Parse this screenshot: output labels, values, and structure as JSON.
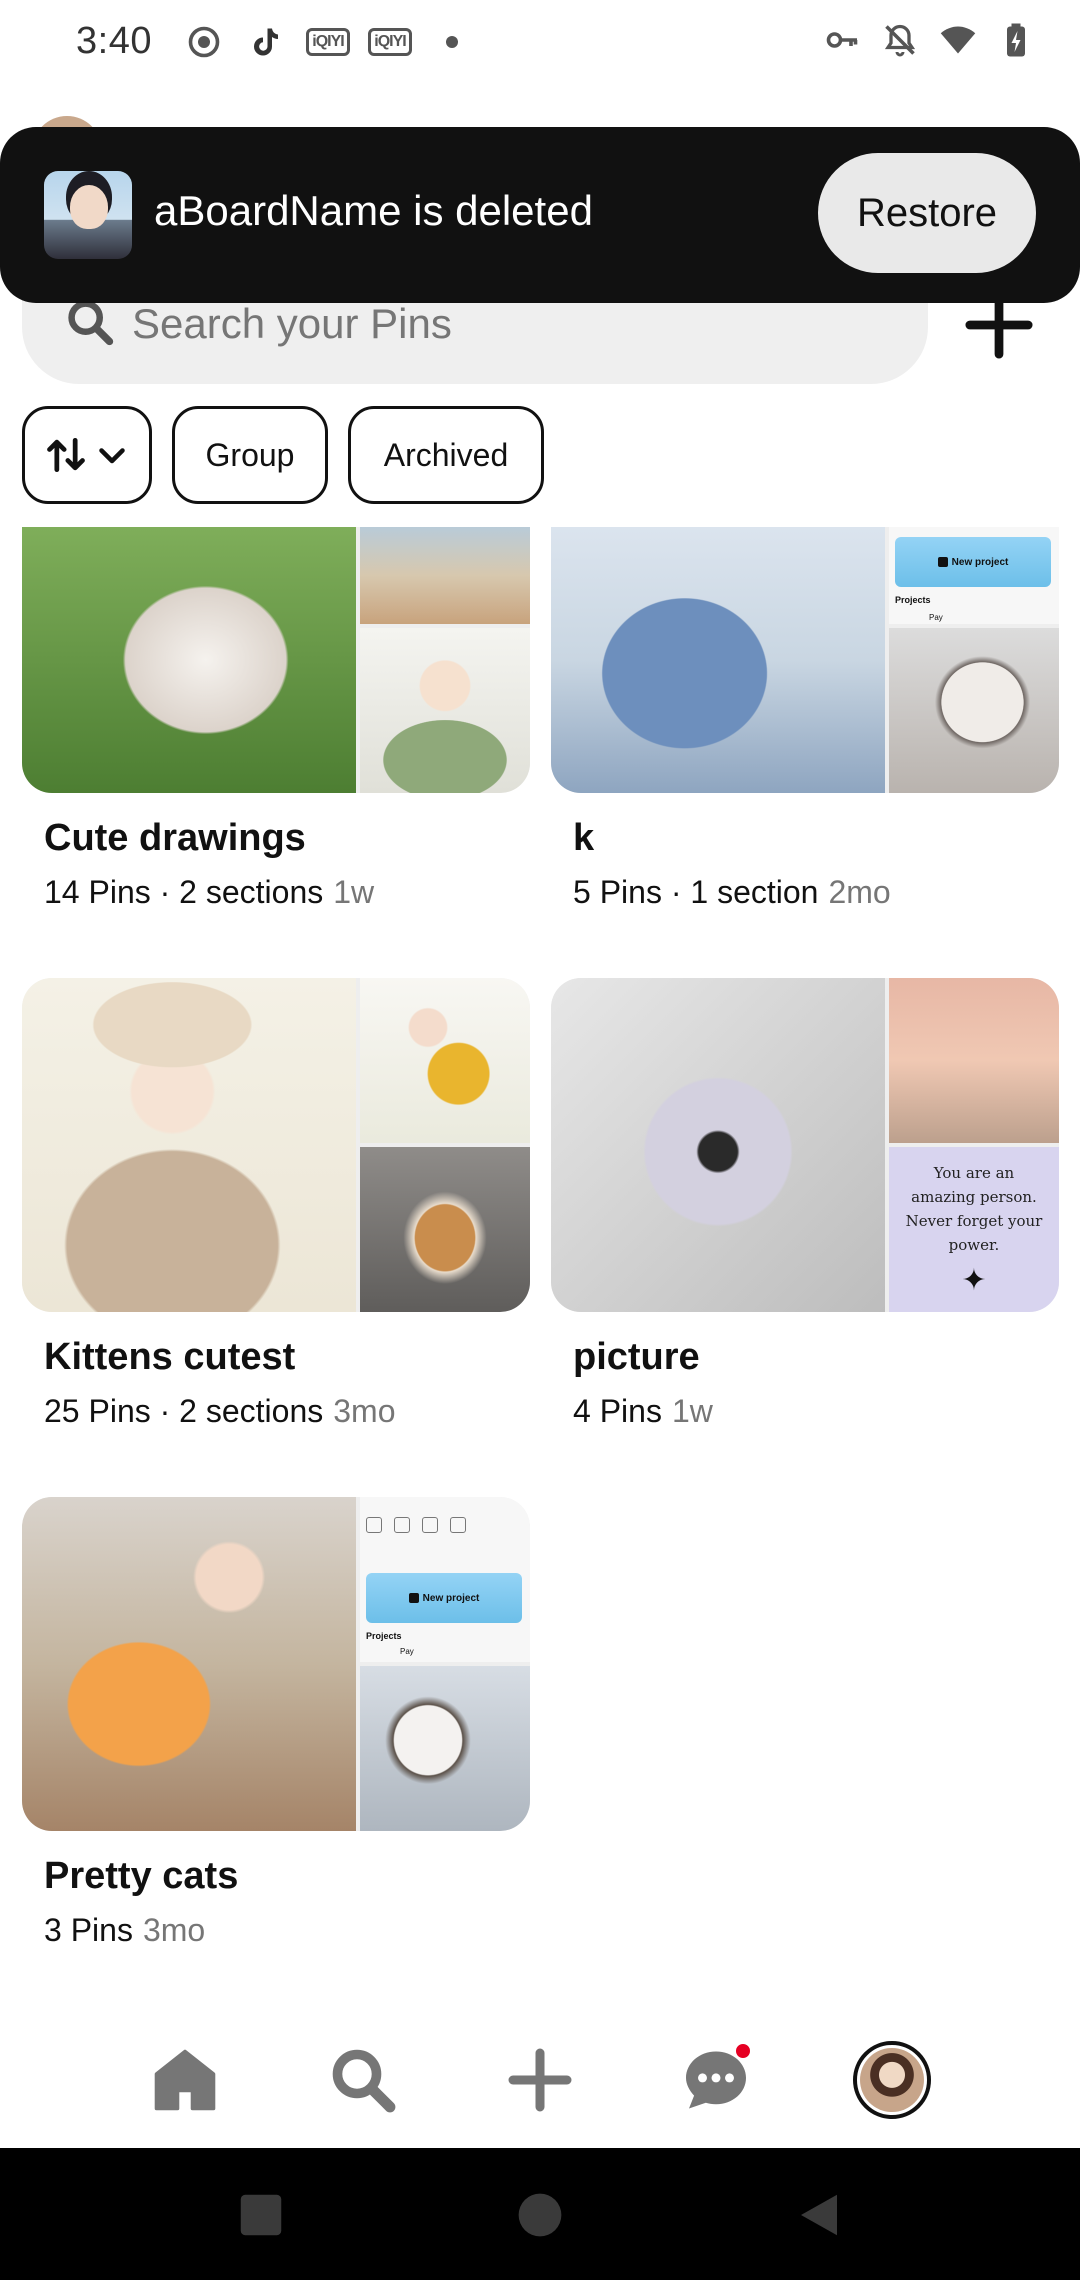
{
  "status_bar": {
    "time": "3:40",
    "left_icons": [
      "record-icon",
      "tiktok-icon",
      "iqiyi-icon",
      "iqiyi-icon",
      "dot-icon"
    ],
    "iqiyi_label": "iQIYI",
    "right_icons": [
      "key-icon",
      "bell-off-icon",
      "wifi-icon",
      "battery-charging-icon"
    ]
  },
  "toast": {
    "message": "aBoardName is deleted",
    "action_label": "Restore"
  },
  "search": {
    "placeholder": "Search your Pins"
  },
  "filters": {
    "chips": [
      {
        "label": "Group"
      },
      {
        "label": "Archived"
      }
    ]
  },
  "boards": [
    {
      "title": "Cute drawings",
      "stats": "14 Pins · 2 sections",
      "age": "1w"
    },
    {
      "title": "k",
      "stats": "5 Pins · 1 section",
      "age": "2mo"
    },
    {
      "title": "Kittens cutest",
      "stats": "25 Pins · 2 sections",
      "age": "3mo"
    },
    {
      "title": "picture",
      "stats": "4 Pins",
      "age": "1w"
    },
    {
      "title": "Pretty cats",
      "stats": "3 Pins",
      "age": "3mo"
    }
  ],
  "tile_texts": {
    "new_project": "New project",
    "projects": "Projects",
    "pay": "Pay",
    "quote": "You are an amazing person. Never forget your power.",
    "star": "✦"
  },
  "bottom_nav": {
    "items": [
      "home-icon",
      "search-icon",
      "create-icon",
      "messages-icon",
      "profile-avatar"
    ],
    "messages_has_badge": true,
    "badge_color": "#e60023"
  },
  "colors": {
    "toast_bg": "#111111",
    "restore_bg": "#e9e9e9",
    "search_bg": "#efefef",
    "muted_text": "#767676"
  }
}
